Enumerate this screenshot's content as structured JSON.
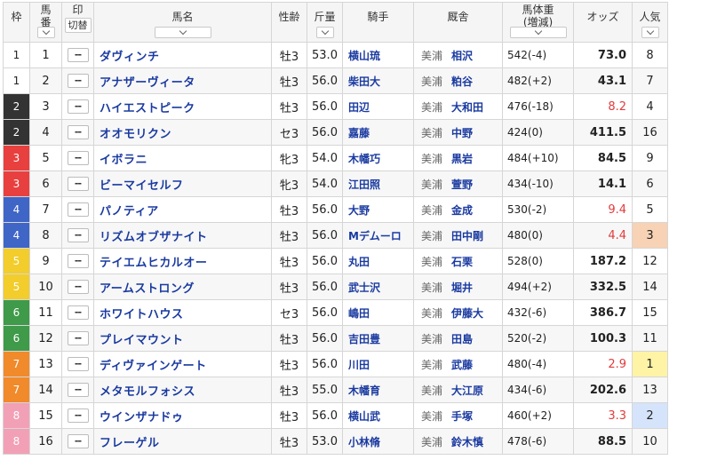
{
  "headers": {
    "waku": "枠",
    "umaban": "馬\n番",
    "mark": "印",
    "mark_toggle": "切替",
    "name": "馬名",
    "sexage": "性齢",
    "weight": "斤量",
    "jockey": "騎手",
    "trainer": "厩舎",
    "body": "馬体重\n(増減)",
    "odds": "オッズ",
    "pop": "人気"
  },
  "colors": {
    "frame1": "#ffffff",
    "frame2": "#333333",
    "frame3": "#e8403f",
    "frame4": "#3f65c7",
    "frame5": "#f2cd2b",
    "frame6": "#3f9a49",
    "frame7": "#f08a2b",
    "frame8": "#f2a0b6",
    "link": "#1a3aa0",
    "odds_hot": "#e03c3c",
    "pop1": "#fff3a5",
    "pop2": "#d5e4fb",
    "pop3": "#f7d2b5"
  },
  "mark_placeholder": "--",
  "rows": [
    {
      "waku": "1",
      "umaban": "1",
      "name": "ダヴィンチ",
      "sexage": "牡3",
      "weight": "53.0",
      "jockey": "横山琉",
      "region": "美浦",
      "trainer": "相沢",
      "body": "542(-4)",
      "odds": "73.0",
      "pop": "8",
      "hot": false
    },
    {
      "waku": "1",
      "umaban": "2",
      "name": "アナザーヴィータ",
      "sexage": "牡3",
      "weight": "56.0",
      "jockey": "柴田大",
      "region": "美浦",
      "trainer": "粕谷",
      "body": "482(+2)",
      "odds": "43.1",
      "pop": "7",
      "hot": false
    },
    {
      "waku": "2",
      "umaban": "3",
      "name": "ハイエストピーク",
      "sexage": "牡3",
      "weight": "56.0",
      "jockey": "田辺",
      "region": "美浦",
      "trainer": "大和田",
      "body": "476(-18)",
      "odds": "8.2",
      "pop": "4",
      "hot": true
    },
    {
      "waku": "2",
      "umaban": "4",
      "name": "オオモリクン",
      "sexage": "セ3",
      "weight": "56.0",
      "jockey": "嘉藤",
      "region": "美浦",
      "trainer": "中野",
      "body": "424(0)",
      "odds": "411.5",
      "pop": "16",
      "hot": false
    },
    {
      "waku": "3",
      "umaban": "5",
      "name": "イボラニ",
      "sexage": "牝3",
      "weight": "54.0",
      "jockey": "木幡巧",
      "region": "美浦",
      "trainer": "黒岩",
      "body": "484(+10)",
      "odds": "84.5",
      "pop": "9",
      "hot": false
    },
    {
      "waku": "3",
      "umaban": "6",
      "name": "ビーマイセルフ",
      "sexage": "牝3",
      "weight": "54.0",
      "jockey": "江田照",
      "region": "美浦",
      "trainer": "萱野",
      "body": "434(-10)",
      "odds": "14.1",
      "pop": "6",
      "hot": false
    },
    {
      "waku": "4",
      "umaban": "7",
      "name": "パノティア",
      "sexage": "牡3",
      "weight": "56.0",
      "jockey": "大野",
      "region": "美浦",
      "trainer": "金成",
      "body": "530(-2)",
      "odds": "9.4",
      "pop": "5",
      "hot": true
    },
    {
      "waku": "4",
      "umaban": "8",
      "name": "リズムオブザナイト",
      "sexage": "牡3",
      "weight": "56.0",
      "jockey": "Mデムーロ",
      "region": "美浦",
      "trainer": "田中剛",
      "body": "480(0)",
      "odds": "4.4",
      "pop": "3",
      "hot": true
    },
    {
      "waku": "5",
      "umaban": "9",
      "name": "テイエムヒカルオー",
      "sexage": "牡3",
      "weight": "56.0",
      "jockey": "丸田",
      "region": "美浦",
      "trainer": "石栗",
      "body": "528(0)",
      "odds": "187.2",
      "pop": "12",
      "hot": false
    },
    {
      "waku": "5",
      "umaban": "10",
      "name": "アームストロング",
      "sexage": "牡3",
      "weight": "56.0",
      "jockey": "武士沢",
      "region": "美浦",
      "trainer": "堀井",
      "body": "494(+2)",
      "odds": "332.5",
      "pop": "14",
      "hot": false
    },
    {
      "waku": "6",
      "umaban": "11",
      "name": "ホワイトハウス",
      "sexage": "セ3",
      "weight": "56.0",
      "jockey": "嶋田",
      "region": "美浦",
      "trainer": "伊藤大",
      "body": "432(-6)",
      "odds": "386.7",
      "pop": "15",
      "hot": false
    },
    {
      "waku": "6",
      "umaban": "12",
      "name": "プレイマウント",
      "sexage": "牡3",
      "weight": "56.0",
      "jockey": "吉田豊",
      "region": "美浦",
      "trainer": "田島",
      "body": "520(-2)",
      "odds": "100.3",
      "pop": "11",
      "hot": false
    },
    {
      "waku": "7",
      "umaban": "13",
      "name": "ディヴァインゲート",
      "sexage": "牡3",
      "weight": "56.0",
      "jockey": "川田",
      "region": "美浦",
      "trainer": "武藤",
      "body": "480(-4)",
      "odds": "2.9",
      "pop": "1",
      "hot": true
    },
    {
      "waku": "7",
      "umaban": "14",
      "name": "メタモルフォシス",
      "sexage": "牡3",
      "weight": "55.0",
      "jockey": "木幡育",
      "region": "美浦",
      "trainer": "大江原",
      "body": "434(-6)",
      "odds": "202.6",
      "pop": "13",
      "hot": false
    },
    {
      "waku": "8",
      "umaban": "15",
      "name": "ウインザナドゥ",
      "sexage": "牡3",
      "weight": "56.0",
      "jockey": "横山武",
      "region": "美浦",
      "trainer": "手塚",
      "body": "460(+2)",
      "odds": "3.3",
      "pop": "2",
      "hot": true
    },
    {
      "waku": "8",
      "umaban": "16",
      "name": "フレーゲル",
      "sexage": "牡3",
      "weight": "53.0",
      "jockey": "小林脩",
      "region": "美浦",
      "trainer": "鈴木慎",
      "body": "478(-6)",
      "odds": "88.5",
      "pop": "10",
      "hot": false
    }
  ]
}
